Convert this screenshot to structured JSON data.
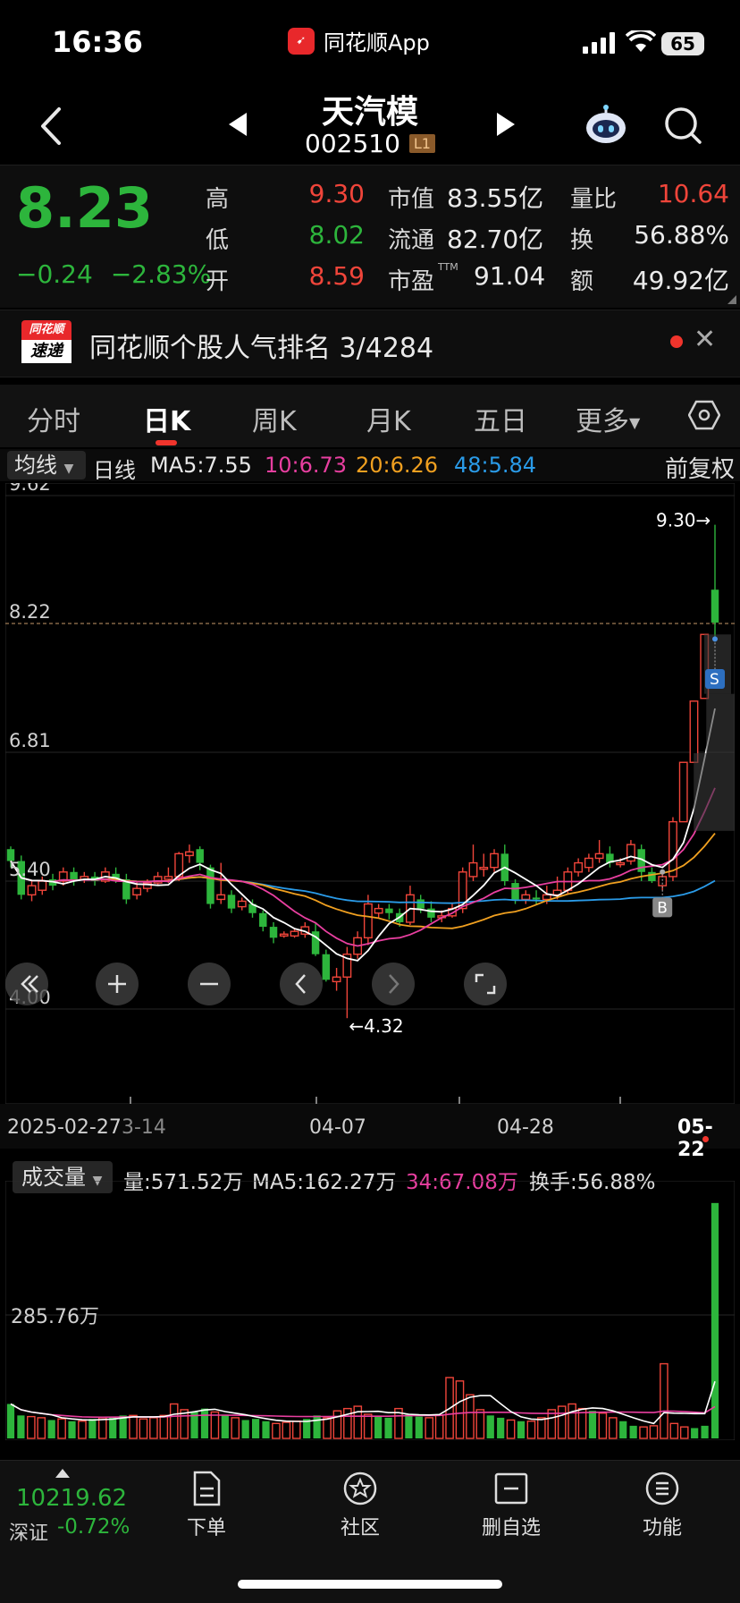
{
  "status_bar": {
    "time": "16:36",
    "app_name": "同花顺App",
    "battery": "65"
  },
  "nav": {
    "stock_name": "天汽模",
    "stock_code": "002510",
    "level_badge": "L1"
  },
  "quote": {
    "price": "8.23",
    "change": "−0.24",
    "change_pct": "−2.83%",
    "high_label": "高",
    "high": "9.30",
    "low_label": "低",
    "low": "8.02",
    "open_label": "开",
    "open": "8.59",
    "mcap_label": "市值",
    "mcap": "83.55亿",
    "float_label": "流通",
    "float": "82.70亿",
    "pe_label": "市盈",
    "pe_sup": "TTM",
    "pe": "91.04",
    "vr_label": "量比",
    "vr": "10.64",
    "turnover_label": "换",
    "turnover": "56.88%",
    "amount_label": "额",
    "amount": "49.92亿"
  },
  "promo": {
    "logo_top": "同花顺",
    "logo_bottom": "速递",
    "text": "同花顺个股人气排名 3/4284"
  },
  "tabs": [
    "分时",
    "日K",
    "周K",
    "月K",
    "五日",
    "更多"
  ],
  "active_tab": "日K",
  "ma_row": {
    "select": "均线",
    "period": "日线",
    "ma5": "MA5:7.55",
    "ma10": "10:6.73",
    "ma20": "20:6.26",
    "ma48": "48:5.84",
    "fuquan": "前复权"
  },
  "colors": {
    "up": "#f0453a",
    "down": "#2db53c",
    "ma5": "#ffffff",
    "ma10": "#e83fa0",
    "ma20": "#f0a020",
    "ma48": "#2a9be8"
  },
  "chart_data": {
    "type": "candlestick",
    "title": "",
    "y_ticks": [
      "9.62",
      "8.22",
      "6.81",
      "5.40",
      "4.00"
    ],
    "ylim": [
      4.0,
      9.62
    ],
    "current_price_line": 8.22,
    "annotations": {
      "high_marker": "9.30→",
      "low_marker": "←4.32",
      "sell_marker": "S",
      "buy_marker": "B"
    },
    "x_labels": [
      "2025-02-27",
      "03-14",
      "04-07",
      "04-28",
      "05-22"
    ],
    "candles": [
      [
        5.75,
        5.62,
        5.78,
        5.55
      ],
      [
        5.62,
        5.25,
        5.68,
        5.2
      ],
      [
        5.25,
        5.35,
        5.4,
        5.18
      ],
      [
        5.3,
        5.4,
        5.45,
        5.25
      ],
      [
        5.42,
        5.35,
        5.48,
        5.3
      ],
      [
        5.4,
        5.5,
        5.55,
        5.35
      ],
      [
        5.5,
        5.4,
        5.55,
        5.35
      ],
      [
        5.42,
        5.45,
        5.5,
        5.38
      ],
      [
        5.45,
        5.4,
        5.5,
        5.35
      ],
      [
        5.4,
        5.5,
        5.55,
        5.38
      ],
      [
        5.48,
        5.42,
        5.55,
        5.38
      ],
      [
        5.42,
        5.2,
        5.48,
        5.15
      ],
      [
        5.25,
        5.32,
        5.4,
        5.2
      ],
      [
        5.32,
        5.38,
        5.42,
        5.28
      ],
      [
        5.38,
        5.45,
        5.5,
        5.35
      ],
      [
        5.42,
        5.45,
        5.55,
        5.38
      ],
      [
        5.45,
        5.7,
        5.72,
        5.4
      ],
      [
        5.68,
        5.72,
        5.8,
        5.6
      ],
      [
        5.75,
        5.6,
        5.78,
        5.52
      ],
      [
        5.55,
        5.15,
        5.58,
        5.1
      ],
      [
        5.2,
        5.25,
        5.6,
        5.15
      ],
      [
        5.25,
        5.1,
        5.3,
        5.05
      ],
      [
        5.12,
        5.18,
        5.22,
        5.08
      ],
      [
        5.15,
        5.05,
        5.2,
        5.0
      ],
      [
        5.05,
        4.9,
        5.08,
        4.85
      ],
      [
        4.9,
        4.78,
        4.95,
        4.72
      ],
      [
        4.8,
        4.82,
        4.85,
        4.78
      ],
      [
        4.8,
        4.85,
        4.88,
        4.78
      ],
      [
        4.82,
        4.9,
        4.95,
        4.78
      ],
      [
        4.85,
        4.6,
        4.95,
        4.58
      ],
      [
        4.6,
        4.32,
        4.65,
        4.3
      ],
      [
        4.3,
        4.35,
        4.45,
        4.2
      ],
      [
        4.35,
        4.6,
        4.68,
        3.9
      ],
      [
        4.6,
        4.78,
        4.85,
        4.55
      ],
      [
        4.78,
        5.15,
        5.25,
        4.7
      ],
      [
        5.05,
        5.1,
        5.15,
        5.0
      ],
      [
        5.1,
        5.05,
        5.15,
        4.98
      ],
      [
        5.05,
        4.95,
        5.1,
        4.9
      ],
      [
        4.95,
        5.25,
        5.35,
        4.92
      ],
      [
        5.2,
        5.1,
        5.25,
        5.05
      ],
      [
        5.1,
        5.0,
        5.18,
        4.95
      ],
      [
        5.0,
        5.02,
        5.08,
        4.95
      ],
      [
        5.02,
        5.1,
        5.15,
        5.0
      ],
      [
        5.1,
        5.5,
        5.55,
        5.05
      ],
      [
        5.45,
        5.6,
        5.8,
        5.4
      ],
      [
        5.55,
        5.55,
        5.7,
        5.45
      ],
      [
        5.55,
        5.7,
        5.75,
        5.5
      ],
      [
        5.7,
        5.4,
        5.8,
        5.35
      ],
      [
        5.38,
        5.2,
        5.42,
        5.15
      ],
      [
        5.2,
        5.25,
        5.3,
        5.15
      ],
      [
        5.22,
        5.2,
        5.3,
        5.15
      ],
      [
        5.2,
        5.25,
        5.35,
        5.15
      ],
      [
        5.25,
        5.3,
        5.45,
        5.2
      ],
      [
        5.3,
        5.5,
        5.55,
        5.25
      ],
      [
        5.5,
        5.6,
        5.65,
        5.45
      ],
      [
        5.55,
        5.65,
        5.7,
        5.5
      ],
      [
        5.65,
        5.7,
        5.85,
        5.6
      ],
      [
        5.7,
        5.6,
        5.78,
        5.55
      ],
      [
        5.6,
        5.6,
        5.65,
        5.55
      ],
      [
        5.62,
        5.8,
        5.85,
        5.58
      ],
      [
        5.75,
        5.5,
        5.8,
        5.4
      ],
      [
        5.5,
        5.4,
        5.55,
        5.38
      ],
      [
        5.35,
        5.45,
        5.5,
        5.3
      ],
      [
        5.45,
        6.05,
        6.1,
        5.4
      ],
      [
        6.05,
        6.7,
        6.7,
        6.05
      ],
      [
        6.7,
        7.37,
        7.37,
        6.7
      ],
      [
        7.4,
        8.1,
        8.1,
        7.4
      ],
      [
        8.59,
        8.23,
        9.3,
        8.02
      ]
    ]
  },
  "date_axis": {
    "d1": "2025-02-27",
    "d2": "3-14",
    "d3": "04-07",
    "d4": "04-28",
    "d5": "05-22"
  },
  "volume": {
    "select": "成交量",
    "vol": "量:571.52万",
    "ma5": "MA5:162.27万",
    "ma34": "34:67.08万",
    "hsl": "换手:56.88%",
    "y_tick": "285.76万",
    "values": [
      60,
      40,
      38,
      36,
      32,
      34,
      30,
      30,
      34,
      36,
      38,
      40,
      40,
      34,
      36,
      40,
      60,
      50,
      46,
      52,
      46,
      40,
      36,
      32,
      34,
      30,
      26,
      28,
      30,
      34,
      40,
      36,
      48,
      52,
      56,
      42,
      38,
      36,
      52,
      42,
      38,
      36,
      40,
      106,
      100,
      76,
      50,
      40,
      36,
      32,
      30,
      30,
      36,
      50,
      56,
      60,
      52,
      48,
      44,
      36,
      30,
      22,
      20,
      22,
      130,
      26,
      20,
      18,
      22,
      410
    ]
  },
  "bottom_bar": {
    "index_value": "10219.62",
    "index_name": "深证",
    "index_change": "-0.72%",
    "items": [
      "下单",
      "社区",
      "删自选",
      "功能"
    ]
  }
}
